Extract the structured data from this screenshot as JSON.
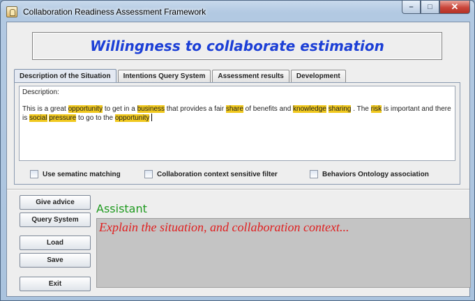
{
  "window": {
    "title": "Collaboration Readiness Assessment Framework",
    "controls": {
      "minimize": "–",
      "maximize": "□",
      "close": "✕"
    }
  },
  "banner": {
    "title": "Willingness to collaborate estimation"
  },
  "tabs": [
    {
      "label": "Description of the Situation",
      "active": true
    },
    {
      "label": "Intentions Query System",
      "active": false
    },
    {
      "label": "Assessment results",
      "active": false
    },
    {
      "label": "Development",
      "active": false
    }
  ],
  "description": {
    "label": "Description:",
    "segments": [
      {
        "text": "This is a great ",
        "hl": false
      },
      {
        "text": "opportunity",
        "hl": true
      },
      {
        "text": " to get in a ",
        "hl": false
      },
      {
        "text": "business",
        "hl": true
      },
      {
        "text": " that provides a fair ",
        "hl": false
      },
      {
        "text": "share",
        "hl": true
      },
      {
        "text": " of benefits and ",
        "hl": false
      },
      {
        "text": "knowledge",
        "hl": true
      },
      {
        "text": " ",
        "hl": false
      },
      {
        "text": "sharing",
        "hl": true
      },
      {
        "text": " . The ",
        "hl": false
      },
      {
        "text": "risk",
        "hl": true
      },
      {
        "text": " is important and there is ",
        "hl": false
      },
      {
        "text": "social",
        "hl": true
      },
      {
        "text": " ",
        "hl": false
      },
      {
        "text": "pressure",
        "hl": true
      },
      {
        "text": " to go to the ",
        "hl": false
      },
      {
        "text": "opportunity",
        "hl": true
      }
    ],
    "highlight_color": "#f0c81e"
  },
  "options": {
    "semantic_matching": {
      "label": "Use sematinc matching",
      "checked": false
    },
    "context_filter": {
      "label": "Collaboration context sensitive filter",
      "checked": false
    },
    "ontology_association": {
      "label": "Behaviors Ontology association",
      "checked": false
    }
  },
  "buttons": {
    "give_advice": "Give advice",
    "query_system": "Query System",
    "load": "Load",
    "save": "Save",
    "exit": "Exit"
  },
  "assistant": {
    "label": "Assistant",
    "message": "Explain the situation, and collaboration context...",
    "label_color": "#1f9a1f",
    "message_color": "#e02020"
  }
}
